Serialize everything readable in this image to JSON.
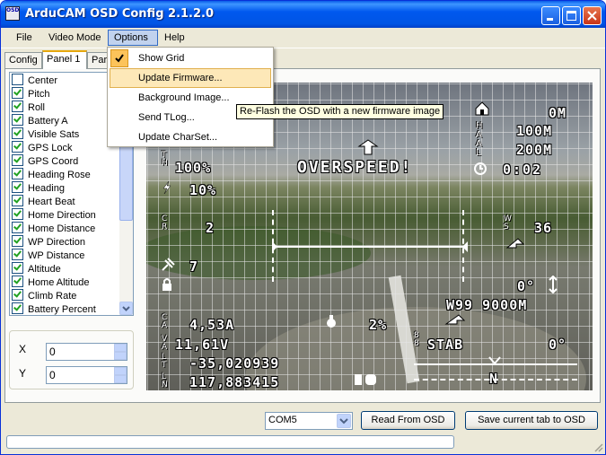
{
  "window": {
    "title": "ArduCAM OSD Config 2.1.2.0",
    "icon_label": "OSD"
  },
  "menu": {
    "file": "File",
    "video_mode": "Video Mode",
    "options": "Options",
    "help": "Help"
  },
  "options_menu": {
    "items": [
      "Show Grid",
      "Update Firmware...",
      "Background Image...",
      "Send TLog...",
      "Update CharSet..."
    ],
    "checked": "Show Grid",
    "highlighted": "Update Firmware..."
  },
  "tooltip": "Re-Flash the OSD with a new firmware image",
  "tabs": [
    "Config",
    "Panel 1",
    "Par"
  ],
  "panels": [
    {
      "label": "Center",
      "checked": false
    },
    {
      "label": "Pitch",
      "checked": true
    },
    {
      "label": "Roll",
      "checked": true
    },
    {
      "label": "Battery A",
      "checked": true
    },
    {
      "label": "Visible Sats",
      "checked": true
    },
    {
      "label": "GPS Lock",
      "checked": true
    },
    {
      "label": "GPS Coord",
      "checked": true
    },
    {
      "label": "Heading Rose",
      "checked": true
    },
    {
      "label": "Heading",
      "checked": true
    },
    {
      "label": "Heart Beat",
      "checked": true
    },
    {
      "label": "Home Direction",
      "checked": true
    },
    {
      "label": "Home Distance",
      "checked": true
    },
    {
      "label": "WP Direction",
      "checked": true
    },
    {
      "label": "WP Distance",
      "checked": true
    },
    {
      "label": "Altitude",
      "checked": true
    },
    {
      "label": "Home Altitude",
      "checked": true
    },
    {
      "label": "Climb Rate",
      "checked": true
    },
    {
      "label": "Battery Percent",
      "checked": true
    }
  ],
  "position": {
    "x_label": "X",
    "x_value": "0",
    "y_label": "Y",
    "y_value": "0"
  },
  "osd": {
    "home_dist": "0M",
    "home_alt": "100M",
    "alt": "200M",
    "warning": "OVERSPEED!",
    "timer": "0:02",
    "throttle": "100%",
    "current_pct": "10%",
    "climb": "2",
    "speed": "36",
    "sats": "7",
    "heading": "0°",
    "waypoint": "W99 9000M",
    "current": "4,53A",
    "rssi": "2%",
    "voltage": "11,61V",
    "mode": "STAB",
    "roll": "0°",
    "lat": "-35,020939",
    "lon": "117,883415",
    "rose_marker": "N"
  },
  "bottom": {
    "com_port": "COM5",
    "read_button": "Read From OSD",
    "save_button": "Save current tab to OSD"
  }
}
